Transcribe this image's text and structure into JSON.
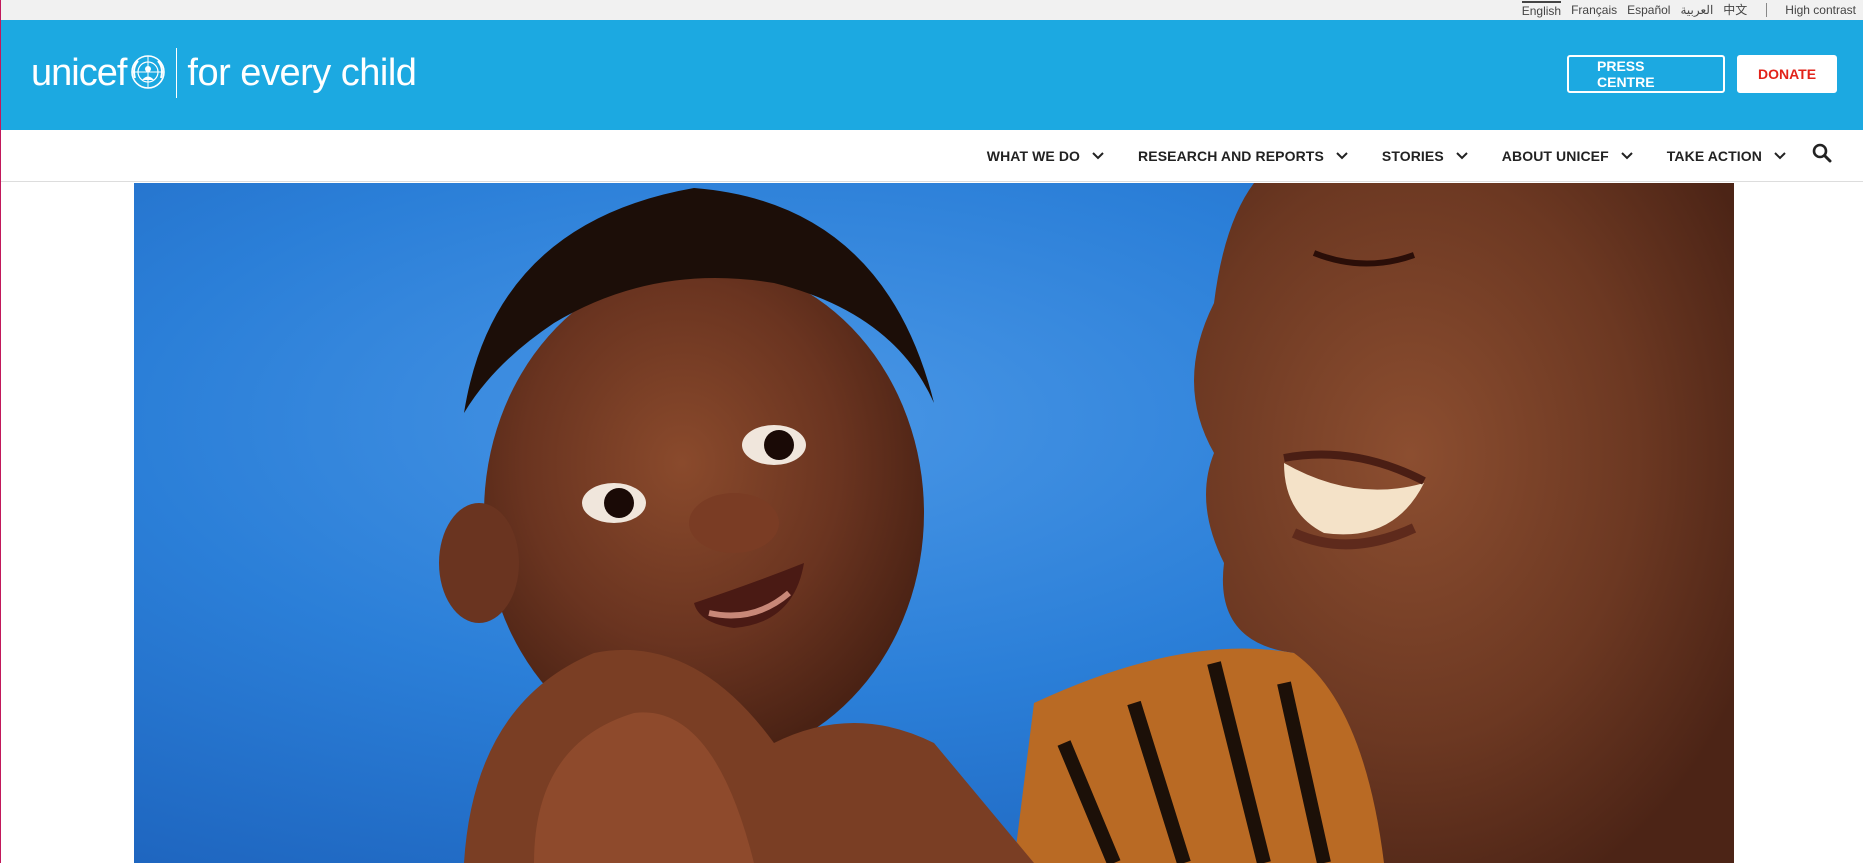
{
  "utility": {
    "languages": [
      "English",
      "Français",
      "Español",
      "العربية",
      "中文"
    ],
    "active_language": "English",
    "high_contrast": "High contrast"
  },
  "header": {
    "logo_word": "unicef",
    "tagline": "for every child",
    "press_centre": "PRESS CENTRE",
    "donate": "DONATE"
  },
  "nav": {
    "items": [
      {
        "label": "WHAT WE DO"
      },
      {
        "label": "RESEARCH AND REPORTS"
      },
      {
        "label": "STORIES"
      },
      {
        "label": "ABOUT UNICEF"
      },
      {
        "label": "TAKE ACTION"
      }
    ]
  },
  "icons": {
    "chevron": "chevron-down-icon",
    "search": "search-icon",
    "emblem": "unicef-emblem-icon"
  },
  "colors": {
    "brand_blue": "#1ca9e1",
    "donate_red": "#e2231a",
    "hero_blue": "#2a7fda"
  }
}
